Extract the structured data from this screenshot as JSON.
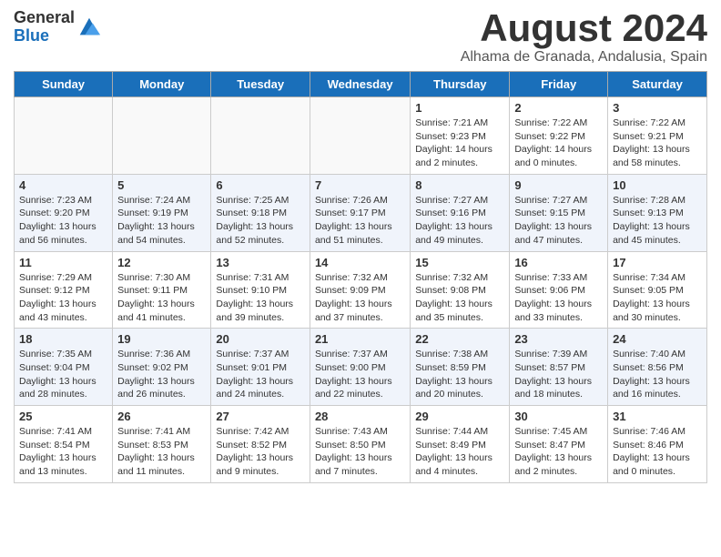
{
  "logo": {
    "general": "General",
    "blue": "Blue"
  },
  "title": "August 2024",
  "location": "Alhama de Granada, Andalusia, Spain",
  "days_of_week": [
    "Sunday",
    "Monday",
    "Tuesday",
    "Wednesday",
    "Thursday",
    "Friday",
    "Saturday"
  ],
  "weeks": [
    [
      {
        "day": "",
        "info": ""
      },
      {
        "day": "",
        "info": ""
      },
      {
        "day": "",
        "info": ""
      },
      {
        "day": "",
        "info": ""
      },
      {
        "day": "1",
        "info": "Sunrise: 7:21 AM\nSunset: 9:23 PM\nDaylight: 14 hours\nand 2 minutes."
      },
      {
        "day": "2",
        "info": "Sunrise: 7:22 AM\nSunset: 9:22 PM\nDaylight: 14 hours\nand 0 minutes."
      },
      {
        "day": "3",
        "info": "Sunrise: 7:22 AM\nSunset: 9:21 PM\nDaylight: 13 hours\nand 58 minutes."
      }
    ],
    [
      {
        "day": "4",
        "info": "Sunrise: 7:23 AM\nSunset: 9:20 PM\nDaylight: 13 hours\nand 56 minutes."
      },
      {
        "day": "5",
        "info": "Sunrise: 7:24 AM\nSunset: 9:19 PM\nDaylight: 13 hours\nand 54 minutes."
      },
      {
        "day": "6",
        "info": "Sunrise: 7:25 AM\nSunset: 9:18 PM\nDaylight: 13 hours\nand 52 minutes."
      },
      {
        "day": "7",
        "info": "Sunrise: 7:26 AM\nSunset: 9:17 PM\nDaylight: 13 hours\nand 51 minutes."
      },
      {
        "day": "8",
        "info": "Sunrise: 7:27 AM\nSunset: 9:16 PM\nDaylight: 13 hours\nand 49 minutes."
      },
      {
        "day": "9",
        "info": "Sunrise: 7:27 AM\nSunset: 9:15 PM\nDaylight: 13 hours\nand 47 minutes."
      },
      {
        "day": "10",
        "info": "Sunrise: 7:28 AM\nSunset: 9:13 PM\nDaylight: 13 hours\nand 45 minutes."
      }
    ],
    [
      {
        "day": "11",
        "info": "Sunrise: 7:29 AM\nSunset: 9:12 PM\nDaylight: 13 hours\nand 43 minutes."
      },
      {
        "day": "12",
        "info": "Sunrise: 7:30 AM\nSunset: 9:11 PM\nDaylight: 13 hours\nand 41 minutes."
      },
      {
        "day": "13",
        "info": "Sunrise: 7:31 AM\nSunset: 9:10 PM\nDaylight: 13 hours\nand 39 minutes."
      },
      {
        "day": "14",
        "info": "Sunrise: 7:32 AM\nSunset: 9:09 PM\nDaylight: 13 hours\nand 37 minutes."
      },
      {
        "day": "15",
        "info": "Sunrise: 7:32 AM\nSunset: 9:08 PM\nDaylight: 13 hours\nand 35 minutes."
      },
      {
        "day": "16",
        "info": "Sunrise: 7:33 AM\nSunset: 9:06 PM\nDaylight: 13 hours\nand 33 minutes."
      },
      {
        "day": "17",
        "info": "Sunrise: 7:34 AM\nSunset: 9:05 PM\nDaylight: 13 hours\nand 30 minutes."
      }
    ],
    [
      {
        "day": "18",
        "info": "Sunrise: 7:35 AM\nSunset: 9:04 PM\nDaylight: 13 hours\nand 28 minutes."
      },
      {
        "day": "19",
        "info": "Sunrise: 7:36 AM\nSunset: 9:02 PM\nDaylight: 13 hours\nand 26 minutes."
      },
      {
        "day": "20",
        "info": "Sunrise: 7:37 AM\nSunset: 9:01 PM\nDaylight: 13 hours\nand 24 minutes."
      },
      {
        "day": "21",
        "info": "Sunrise: 7:37 AM\nSunset: 9:00 PM\nDaylight: 13 hours\nand 22 minutes."
      },
      {
        "day": "22",
        "info": "Sunrise: 7:38 AM\nSunset: 8:59 PM\nDaylight: 13 hours\nand 20 minutes."
      },
      {
        "day": "23",
        "info": "Sunrise: 7:39 AM\nSunset: 8:57 PM\nDaylight: 13 hours\nand 18 minutes."
      },
      {
        "day": "24",
        "info": "Sunrise: 7:40 AM\nSunset: 8:56 PM\nDaylight: 13 hours\nand 16 minutes."
      }
    ],
    [
      {
        "day": "25",
        "info": "Sunrise: 7:41 AM\nSunset: 8:54 PM\nDaylight: 13 hours\nand 13 minutes."
      },
      {
        "day": "26",
        "info": "Sunrise: 7:41 AM\nSunset: 8:53 PM\nDaylight: 13 hours\nand 11 minutes."
      },
      {
        "day": "27",
        "info": "Sunrise: 7:42 AM\nSunset: 8:52 PM\nDaylight: 13 hours\nand 9 minutes."
      },
      {
        "day": "28",
        "info": "Sunrise: 7:43 AM\nSunset: 8:50 PM\nDaylight: 13 hours\nand 7 minutes."
      },
      {
        "day": "29",
        "info": "Sunrise: 7:44 AM\nSunset: 8:49 PM\nDaylight: 13 hours\nand 4 minutes."
      },
      {
        "day": "30",
        "info": "Sunrise: 7:45 AM\nSunset: 8:47 PM\nDaylight: 13 hours\nand 2 minutes."
      },
      {
        "day": "31",
        "info": "Sunrise: 7:46 AM\nSunset: 8:46 PM\nDaylight: 13 hours\nand 0 minutes."
      }
    ]
  ]
}
